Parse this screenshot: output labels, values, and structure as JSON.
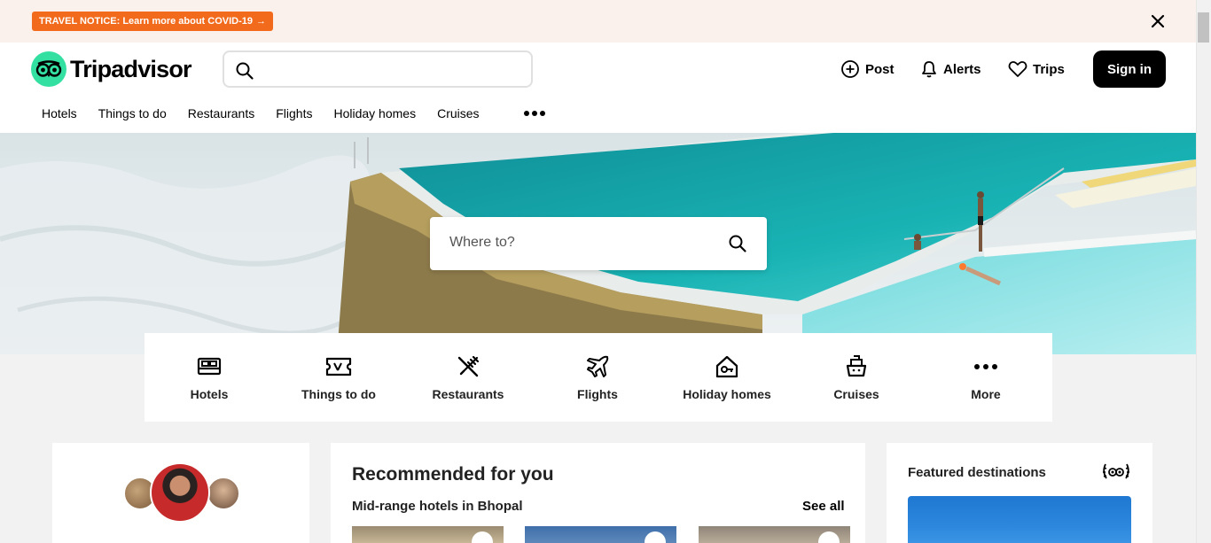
{
  "notice": {
    "label": "TRAVEL NOTICE: Learn more about COVID-19",
    "arrow": "→"
  },
  "brand": {
    "name": "Tripadvisor",
    "accent": "#34e0a1",
    "notice_color": "#f26b1d"
  },
  "header": {
    "search_placeholder": "",
    "post_label": "Post",
    "alerts_label": "Alerts",
    "trips_label": "Trips",
    "signin_label": "Sign in"
  },
  "nav": {
    "items": [
      "Hotels",
      "Things to do",
      "Restaurants",
      "Flights",
      "Holiday homes",
      "Cruises"
    ]
  },
  "hero": {
    "search_placeholder": "Where to?"
  },
  "categories": [
    {
      "label": "Hotels",
      "icon": "bed-icon"
    },
    {
      "label": "Things to do",
      "icon": "ticket-icon"
    },
    {
      "label": "Restaurants",
      "icon": "fork-knife-icon"
    },
    {
      "label": "Flights",
      "icon": "plane-icon"
    },
    {
      "label": "Holiday homes",
      "icon": "house-key-icon"
    },
    {
      "label": "Cruises",
      "icon": "ship-icon"
    },
    {
      "label": "More",
      "icon": "more-dots-icon"
    }
  ],
  "recommended": {
    "title": "Recommended for you",
    "subtitle": "Mid-range hotels in Bhopal",
    "see_all": "See all"
  },
  "featured": {
    "title": "Featured destinations"
  }
}
